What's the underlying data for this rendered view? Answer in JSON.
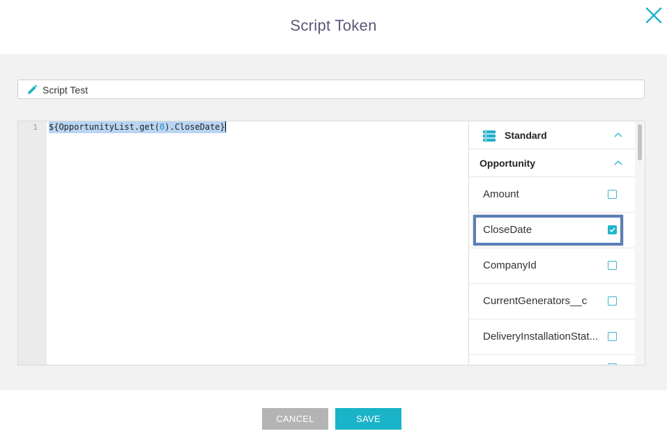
{
  "dialog": {
    "title": "Script Token"
  },
  "name_field": {
    "value": "Script Test"
  },
  "editor": {
    "line_number": "1",
    "code_prefix": "${OpportunityList.get(",
    "code_number": "0",
    "code_suffix": ").CloseDate}"
  },
  "field_picker": {
    "group_label": "Standard",
    "object_label": "Opportunity",
    "fields": [
      {
        "label": "Amount",
        "checked": false
      },
      {
        "label": "CloseDate",
        "checked": true
      },
      {
        "label": "CompanyId",
        "checked": false
      },
      {
        "label": "CurrentGenerators__c",
        "checked": false
      },
      {
        "label": "DeliveryInstallationStat...",
        "checked": false
      }
    ]
  },
  "footer": {
    "cancel_label": "CANCEL",
    "save_label": "SAVE"
  },
  "colors": {
    "accent": "#1ab3c8",
    "title_text": "#5f5579",
    "cancel_bg": "#b4b4b4",
    "selection_border": "#5a7fb8",
    "code_selection": "#b9d5f3"
  },
  "icons": {
    "close": "close-icon",
    "pencil": "pencil-icon",
    "standard": "database-icon",
    "collapse": "chevron-up-icon",
    "checkbox_checked": "check-icon"
  }
}
